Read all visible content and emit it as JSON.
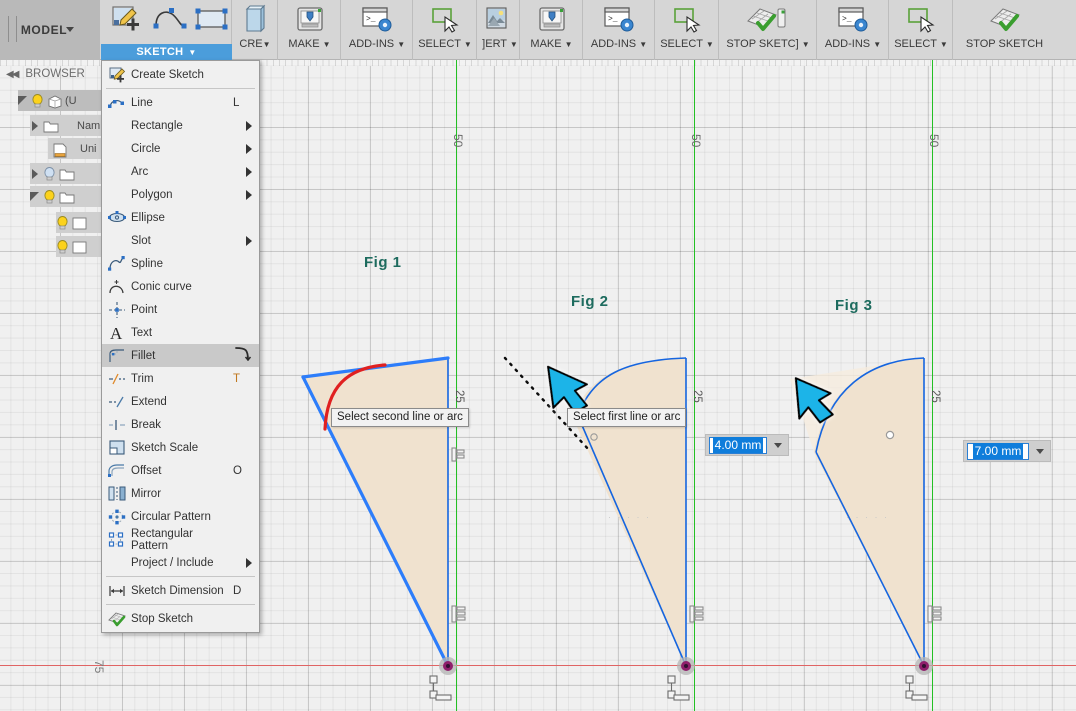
{
  "app": {
    "workspace_label": "MODEL",
    "active_tab": "SKETCH"
  },
  "toolbar": {
    "groups": [
      {
        "name": "sketch-group",
        "buttons": [
          {
            "label": "",
            "icon": "create-sketch-icon",
            "caret": false
          },
          {
            "label": "",
            "icon": "spline-icon",
            "caret": false
          },
          {
            "label": "",
            "icon": "rectangle-icon",
            "caret": false
          }
        ]
      }
    ],
    "items": [
      {
        "label": "CRE",
        "icon": "create-icon",
        "caret": true
      },
      {
        "label": "MAKE",
        "icon": "make-3dprint-icon",
        "caret": true
      },
      {
        "label": "ADD-INS",
        "icon": "addins-script-icon",
        "caret": true
      },
      {
        "label": "SELECT",
        "icon": "select-cursor-icon",
        "caret": true
      },
      {
        "label": "INSERT",
        "icon": "insert-image-icon",
        "caret": true
      },
      {
        "label": "MAKE",
        "icon": "make-3dprint-icon",
        "caret": true
      },
      {
        "label": "ADD-INS",
        "icon": "addins-script-icon",
        "caret": true
      },
      {
        "label": "SELECT",
        "icon": "select-cursor-icon",
        "caret": true
      },
      {
        "label": "STOP SKETCH",
        "icon": "stop-sketch-icon",
        "caret": true
      },
      {
        "label": "ADD-INS",
        "icon": "addins-script-icon",
        "caret": true
      },
      {
        "label": "SELECT",
        "icon": "select-cursor-icon",
        "caret": true
      },
      {
        "label": "STOP SKETCH",
        "icon": "stop-sketch-icon",
        "caret": false
      }
    ]
  },
  "browser": {
    "title": "BROWSER",
    "collapse_glyph": "◀◀",
    "nodes": [
      {
        "label": "(U",
        "icon": "body-cube-icon",
        "bulb": "on",
        "twisty": "open",
        "indent": 22,
        "selected": true
      },
      {
        "label": "Nam",
        "icon": "folder-icon",
        "bulb": "none",
        "twisty": "collapsed",
        "indent": 32
      },
      {
        "label": "Uni",
        "icon": "document-ruler-icon",
        "bulb": "none",
        "twisty": "none",
        "indent": 50
      },
      {
        "label": "",
        "icon": "folder-icon",
        "bulb": "off",
        "twisty": "collapsed",
        "indent": 32
      },
      {
        "label": "",
        "icon": "folder-icon",
        "bulb": "on",
        "twisty": "open",
        "indent": 32
      },
      {
        "label": "",
        "icon": "sketch-icon",
        "bulb": "on",
        "twisty": "none",
        "indent": 58
      },
      {
        "label": "",
        "icon": "sketch-icon",
        "bulb": "on",
        "twisty": "none",
        "indent": 58
      }
    ]
  },
  "menu": {
    "name": "sketch-dropdown-menu",
    "items": [
      {
        "label": "Create Sketch",
        "key": "",
        "icon": "create-sketch-icon",
        "arrow": false,
        "highlight": false,
        "sep_after": true
      },
      {
        "label": "Line",
        "key": "L",
        "icon": "line-icon",
        "arrow": false,
        "highlight": false
      },
      {
        "label": "Rectangle",
        "key": "",
        "icon": "",
        "arrow": true,
        "highlight": false
      },
      {
        "label": "Circle",
        "key": "",
        "icon": "",
        "arrow": true,
        "highlight": false
      },
      {
        "label": "Arc",
        "key": "",
        "icon": "",
        "arrow": true,
        "highlight": false
      },
      {
        "label": "Polygon",
        "key": "",
        "icon": "",
        "arrow": true,
        "highlight": false
      },
      {
        "label": "Ellipse",
        "key": "",
        "icon": "ellipse-icon",
        "arrow": false,
        "highlight": false
      },
      {
        "label": "Slot",
        "key": "",
        "icon": "",
        "arrow": true,
        "highlight": false
      },
      {
        "label": "Spline",
        "key": "",
        "icon": "spline-icon",
        "arrow": false,
        "highlight": false
      },
      {
        "label": "Conic curve",
        "key": "",
        "icon": "conic-curve-icon",
        "arrow": false,
        "highlight": false
      },
      {
        "label": "Point",
        "key": "",
        "icon": "point-icon",
        "arrow": false,
        "highlight": false
      },
      {
        "label": "Text",
        "key": "",
        "icon": "text-icon",
        "arrow": false,
        "highlight": false
      },
      {
        "label": "Fillet",
        "key": "",
        "icon": "fillet-icon",
        "arrow": false,
        "highlight": true,
        "trail": "fillet-glyph"
      },
      {
        "label": "Trim",
        "key": "T",
        "icon": "trim-icon",
        "arrow": false,
        "highlight": false
      },
      {
        "label": "Extend",
        "key": "",
        "icon": "extend-icon",
        "arrow": false,
        "highlight": false
      },
      {
        "label": "Break",
        "key": "",
        "icon": "break-icon",
        "arrow": false,
        "highlight": false
      },
      {
        "label": "Sketch Scale",
        "key": "",
        "icon": "sketch-scale-icon",
        "arrow": false,
        "highlight": false
      },
      {
        "label": "Offset",
        "key": "O",
        "icon": "offset-icon",
        "arrow": false,
        "highlight": false
      },
      {
        "label": "Mirror",
        "key": "",
        "icon": "mirror-icon",
        "arrow": false,
        "highlight": false
      },
      {
        "label": "Circular Pattern",
        "key": "",
        "icon": "circular-pattern-icon",
        "arrow": false,
        "highlight": false
      },
      {
        "label": "Rectangular Pattern",
        "key": "",
        "icon": "rectangular-pattern-icon",
        "arrow": false,
        "highlight": false
      },
      {
        "label": "Project / Include",
        "key": "",
        "icon": "",
        "arrow": true,
        "highlight": false,
        "sep_after": true
      },
      {
        "label": "Sketch Dimension",
        "key": "D",
        "icon": "sketch-dimension-icon",
        "arrow": false,
        "highlight": false,
        "sep_after": true
      },
      {
        "label": "Stop Sketch",
        "key": "",
        "icon": "stop-sketch-icon",
        "arrow": false,
        "highlight": false
      }
    ]
  },
  "canvas": {
    "figures": [
      {
        "id": "fig1",
        "label": "Fig 1",
        "dim_label": "25",
        "axis_label": "50"
      },
      {
        "id": "fig2",
        "label": "Fig 2",
        "dim_label": "25",
        "axis_label": "50"
      },
      {
        "id": "fig3",
        "label": "Fig 3",
        "dim_label": "25",
        "axis_label": "50"
      }
    ],
    "ruler_label": "75",
    "tooltips": [
      {
        "id": "tip1",
        "text": "Select second line or arc"
      },
      {
        "id": "tip2",
        "text": "Select first line or arc"
      }
    ],
    "dimension_inputs": [
      {
        "id": "radius-input-fig2",
        "value": "4.00 mm"
      },
      {
        "id": "radius-input-fig3",
        "value": "7.00 mm"
      }
    ],
    "colors": {
      "sketch_line": "#1565e0",
      "sketch_selected": "#2d7dfa",
      "fillet_preview": "#e02020",
      "fill": "#f0e2cf",
      "x_axis": "#e06464",
      "y_axis": "#24c024",
      "annotation_arrow": "#1ab4e8",
      "fig_label": "#1d6b5e",
      "accent": "#4b9ddb"
    }
  }
}
